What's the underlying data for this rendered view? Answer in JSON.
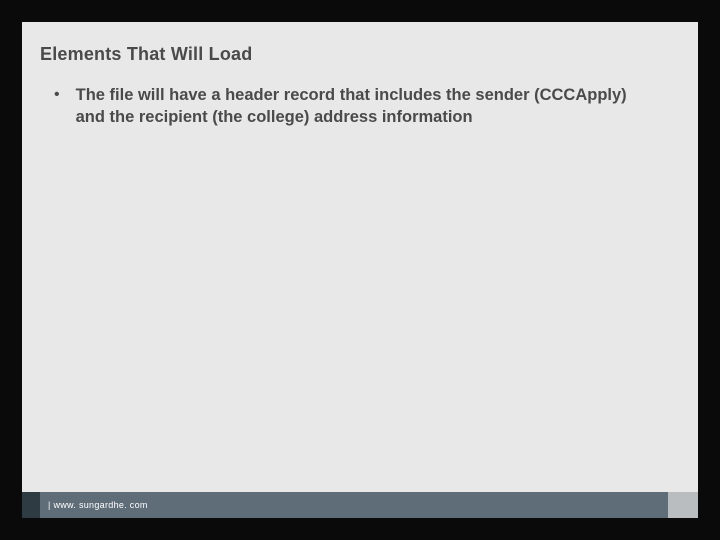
{
  "slide": {
    "title": "Elements That Will Load",
    "bullets": [
      "The file will have a header record that includes the sender (CCCApply) and the recipient (the college) address information"
    ]
  },
  "footer": {
    "url": "| www. sungardhe. com"
  },
  "colors": {
    "slide_bg": "#e8e8e8",
    "footer_dark": "#2f3b42",
    "footer_bar": "#5e6d78",
    "footer_light": "#b9bdbf",
    "text": "#4a4a4a"
  }
}
